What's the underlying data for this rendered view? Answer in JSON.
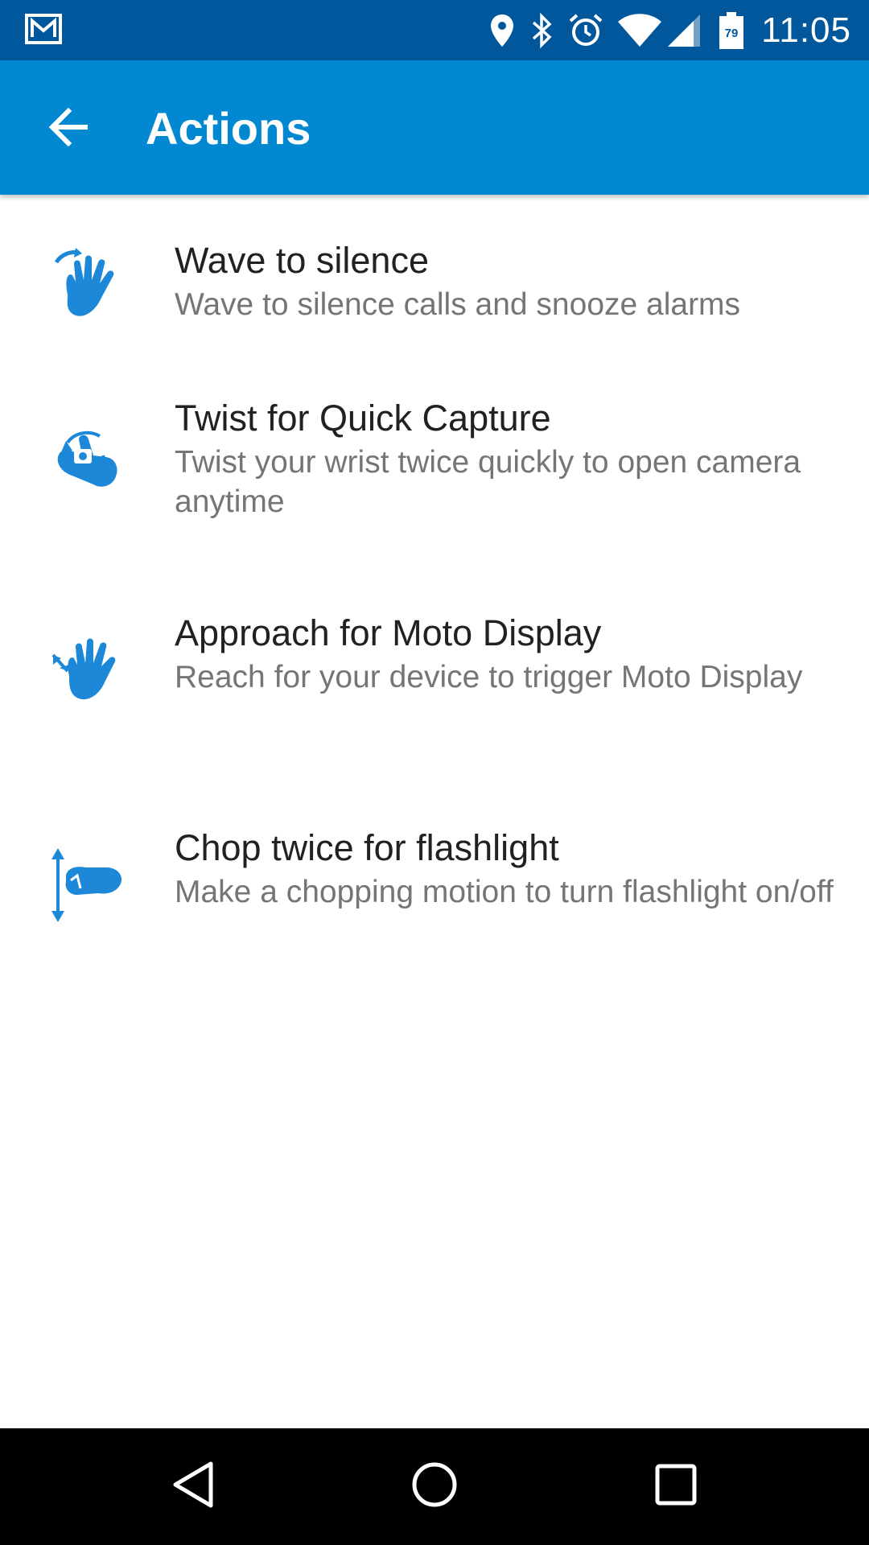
{
  "status_bar": {
    "time": "11:05",
    "battery_level": "79",
    "icons": [
      "gmail-icon",
      "location-icon",
      "bluetooth-icon",
      "alarm-icon",
      "wifi-icon",
      "signal-icon",
      "battery-icon"
    ]
  },
  "app_bar": {
    "title": "Actions",
    "back_icon": "arrow-back-icon",
    "color": "#0288d1"
  },
  "items": [
    {
      "title": "Wave to silence",
      "subtitle": "Wave to silence calls and snooze alarms",
      "icon": "wave-hand-icon"
    },
    {
      "title": "Twist for Quick Capture",
      "subtitle": "Twist your wrist twice quickly to open camera anytime",
      "icon": "twist-camera-icon"
    },
    {
      "title": "Approach for Moto Display",
      "subtitle": "Reach for your device to trigger Moto Display",
      "icon": "approach-hand-icon"
    },
    {
      "title": "Chop twice for flashlight",
      "subtitle": "Make a chopping motion to turn flashlight on/off",
      "icon": "chop-hand-icon"
    }
  ],
  "nav_bar": {
    "icons": [
      "back-triangle-icon",
      "home-circle-icon",
      "recents-square-icon"
    ]
  },
  "colors": {
    "status_bar": "#01579b",
    "accent": "#0288d1",
    "title_text": "#212121",
    "subtitle_text": "#757575"
  }
}
